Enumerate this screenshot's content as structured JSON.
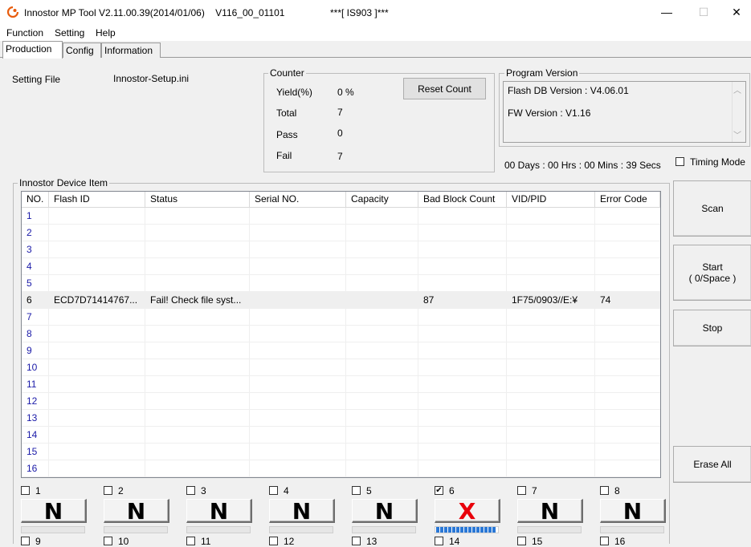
{
  "window": {
    "title": "Innostor MP Tool V2.11.00.39(2014/01/06)    V116_00_01101",
    "title_center": "***[ IS903 ]***",
    "minimize_glyph": "—",
    "maximize_glyph": "☐",
    "close_glyph": "✕"
  },
  "menu": [
    "Function",
    "Setting",
    "Help"
  ],
  "tabs": [
    "Production",
    "Config",
    "Information"
  ],
  "setting_file": {
    "label": "Setting File",
    "value": "Innostor-Setup.ini"
  },
  "counter": {
    "title": "Counter",
    "yield_label": "Yield(%)",
    "yield_value": "0 %",
    "total_label": "Total",
    "total_value": "7",
    "pass_label": "Pass",
    "pass_value": "0",
    "fail_label": "Fail",
    "fail_value": "7",
    "reset_button": "Reset Count"
  },
  "program_version": {
    "title": "Program Version",
    "flash_db": "Flash DB Version :  V4.06.01",
    "fw": "FW Version :    V1.16",
    "scroll_up": "︿",
    "scroll_down": "﹀"
  },
  "elapsed": "00 Days : 00 Hrs : 00 Mins : 39 Secs",
  "timing_mode": "Timing Mode",
  "device_group": "Innostor Device Item",
  "table": {
    "columns": [
      "NO.",
      "Flash ID",
      "Status",
      "Serial NO.",
      "Capacity",
      "Bad Block Count",
      "VID/PID",
      "Error Code"
    ],
    "rows": [
      [
        "1",
        "",
        "",
        "",
        "",
        "",
        "",
        ""
      ],
      [
        "2",
        "",
        "",
        "",
        "",
        "",
        "",
        ""
      ],
      [
        "3",
        "",
        "",
        "",
        "",
        "",
        "",
        ""
      ],
      [
        "4",
        "",
        "",
        "",
        "",
        "",
        "",
        ""
      ],
      [
        "5",
        "",
        "",
        "",
        "",
        "",
        "",
        ""
      ],
      [
        "6",
        "ECD7D71414767...",
        "Fail!  Check file syst...",
        "",
        "",
        "87",
        "1F75/0903//E:¥",
        "74"
      ],
      [
        "7",
        "",
        "",
        "",
        "",
        "",
        "",
        ""
      ],
      [
        "8",
        "",
        "",
        "",
        "",
        "",
        "",
        ""
      ],
      [
        "9",
        "",
        "",
        "",
        "",
        "",
        "",
        ""
      ],
      [
        "10",
        "",
        "",
        "",
        "",
        "",
        "",
        ""
      ],
      [
        "11",
        "",
        "",
        "",
        "",
        "",
        "",
        ""
      ],
      [
        "12",
        "",
        "",
        "",
        "",
        "",
        "",
        ""
      ],
      [
        "13",
        "",
        "",
        "",
        "",
        "",
        "",
        ""
      ],
      [
        "14",
        "",
        "",
        "",
        "",
        "",
        "",
        ""
      ],
      [
        "15",
        "",
        "",
        "",
        "",
        "",
        "",
        ""
      ],
      [
        "16",
        "",
        "",
        "",
        "",
        "",
        "",
        ""
      ]
    ]
  },
  "side_buttons": {
    "scan": "Scan",
    "start_line1": "Start",
    "start_line2": "( 0/Space )",
    "stop": "Stop",
    "erase_all": "Erase All"
  },
  "ports": [
    {
      "num": "1",
      "checked": false,
      "status": "N",
      "progress": 0
    },
    {
      "num": "2",
      "checked": false,
      "status": "N",
      "progress": 0
    },
    {
      "num": "3",
      "checked": false,
      "status": "N",
      "progress": 0
    },
    {
      "num": "4",
      "checked": false,
      "status": "N",
      "progress": 0
    },
    {
      "num": "5",
      "checked": false,
      "status": "N",
      "progress": 0
    },
    {
      "num": "6",
      "checked": true,
      "status": "X",
      "progress": 1
    },
    {
      "num": "7",
      "checked": false,
      "status": "N",
      "progress": 0
    },
    {
      "num": "8",
      "checked": false,
      "status": "N",
      "progress": 0
    }
  ],
  "ports_row2": [
    "9",
    "10",
    "11",
    "12",
    "13",
    "14",
    "15",
    "16"
  ],
  "colors": {
    "fail": "#e8000b",
    "progress": "#2a78d6",
    "link_number": "#1a1aa8"
  }
}
